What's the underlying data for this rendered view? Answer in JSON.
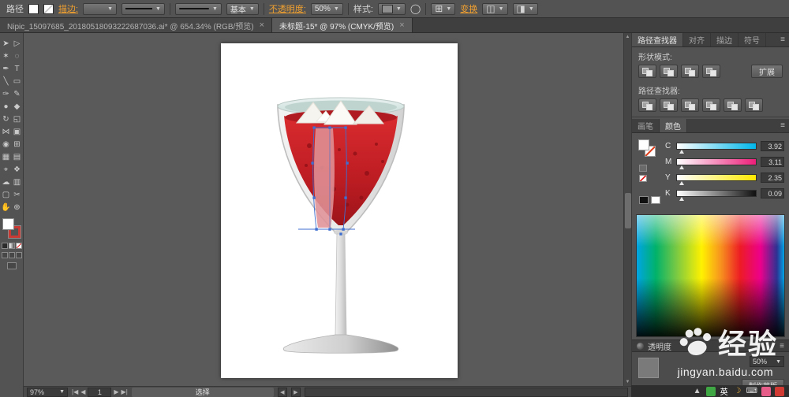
{
  "colors": {
    "accent_orange": "#f0a030",
    "panel_bg": "#535353",
    "canvas_bg": "#5a5a5a"
  },
  "control_bar": {
    "selection_type": "路径",
    "stroke_label": "描边:",
    "brush_name": "基本",
    "opacity_label": "不透明度:",
    "opacity_value": "50%",
    "style_label": "样式:",
    "transform_label": "变换"
  },
  "document_tabs": [
    {
      "title": "Nipic_15097685_20180518093222687036.ai* @ 654.34% (RGB/预览)",
      "close_label": "×",
      "is_active": false
    },
    {
      "title": "未标题-15* @ 97% (CMYK/预览)",
      "close_label": "×",
      "is_active": true
    }
  ],
  "tools": [
    {
      "name": "selection",
      "glyph": "➤"
    },
    {
      "name": "direct-selection",
      "glyph": "▷"
    },
    {
      "name": "magic-wand",
      "glyph": "✶"
    },
    {
      "name": "lasso",
      "glyph": "◌"
    },
    {
      "name": "pen",
      "glyph": "✒"
    },
    {
      "name": "type",
      "glyph": "T"
    },
    {
      "name": "line-segment",
      "glyph": "╲"
    },
    {
      "name": "rectangle",
      "glyph": "▭"
    },
    {
      "name": "paintbrush",
      "glyph": "✑"
    },
    {
      "name": "pencil",
      "glyph": "✎"
    },
    {
      "name": "blob-brush",
      "glyph": "●"
    },
    {
      "name": "eraser",
      "glyph": "◆"
    },
    {
      "name": "rotate",
      "glyph": "↻"
    },
    {
      "name": "scale",
      "glyph": "◱"
    },
    {
      "name": "width",
      "glyph": "⋈"
    },
    {
      "name": "free-transform",
      "glyph": "▣"
    },
    {
      "name": "shape-builder",
      "glyph": "◉"
    },
    {
      "name": "perspective-grid",
      "glyph": "⊞"
    },
    {
      "name": "mesh",
      "glyph": "▦"
    },
    {
      "name": "gradient",
      "glyph": "▤"
    },
    {
      "name": "eyedropper",
      "glyph": "⌖"
    },
    {
      "name": "blend",
      "glyph": "❖"
    },
    {
      "name": "symbol-sprayer",
      "glyph": "☁"
    },
    {
      "name": "column-graph",
      "glyph": "▥"
    },
    {
      "name": "artboard",
      "glyph": "▢"
    },
    {
      "name": "slice",
      "glyph": "✂"
    },
    {
      "name": "hand",
      "glyph": "✋"
    },
    {
      "name": "zoom",
      "glyph": "⊕"
    }
  ],
  "right_panels": {
    "tab_row": [
      "路径查找器",
      "对齐",
      "描边",
      "符号"
    ],
    "shape_modes_label": "形状模式:",
    "shape_mode_buttons": [
      "unite",
      "minus-front",
      "intersect",
      "exclude"
    ],
    "expand_button": "扩展",
    "pathfinders_label": "路径查找器:",
    "pathfinder_buttons": [
      "divide",
      "trim",
      "merge",
      "crop",
      "outline",
      "minus-back"
    ],
    "color_tabs": [
      "画笔",
      "颜色"
    ],
    "color_sliders": [
      {
        "channel": "C",
        "value": "3.92",
        "color": "#00b7ea"
      },
      {
        "channel": "M",
        "value": "3.11",
        "color": "#ec1e79"
      },
      {
        "channel": "Y",
        "value": "2.35",
        "color": "#ffe800"
      },
      {
        "channel": "K",
        "value": "0.09",
        "color": "#101010"
      }
    ],
    "transparency": {
      "title": "透明度",
      "opacity_value": "50%",
      "make_mask_button": "制作蒙版"
    }
  },
  "status_bar": {
    "zoom_value": "97%",
    "artboard_number": "1",
    "status_text": "选择"
  },
  "watermark": {
    "brand_text": "经验",
    "url_text": "jingyan.baidu.com"
  },
  "taskbar": {
    "icons": [
      {
        "name": "expand-arrow",
        "glyph": "▲",
        "fg": "#c9c9c9"
      },
      {
        "name": "green-app",
        "glyph": "",
        "bg": "#3fa845"
      },
      {
        "name": "input-method",
        "glyph": "英",
        "fg": "#ffffff"
      },
      {
        "name": "moon",
        "glyph": "☽",
        "fg": "#f6b73c"
      },
      {
        "name": "keyboard",
        "glyph": "⌨",
        "fg": "#dddddd"
      },
      {
        "name": "pink-app",
        "glyph": "",
        "bg": "#e75d8a"
      },
      {
        "name": "red-app",
        "glyph": "",
        "bg": "#d03a32"
      }
    ]
  }
}
